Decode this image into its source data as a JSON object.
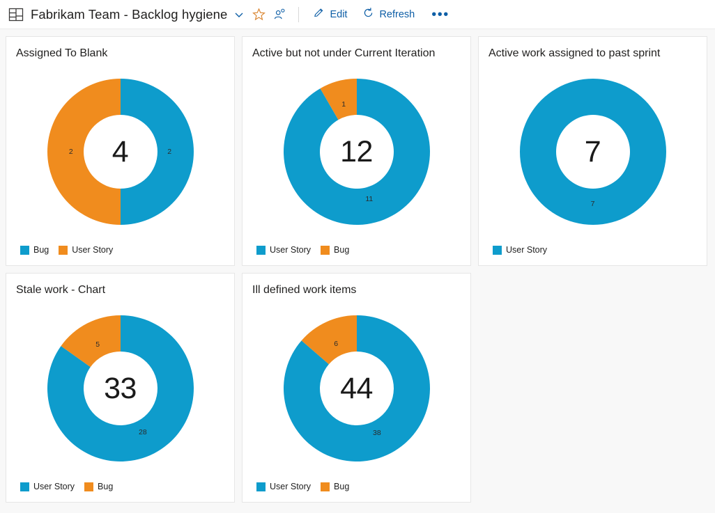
{
  "header": {
    "dashboard_icon": "dashboard-grid-icon",
    "title": "Fabrikam Team - Backlog hygiene",
    "chevron_icon": "chevron-down-icon",
    "favorite_icon": "star-icon",
    "share_icon": "people-icon",
    "edit": {
      "icon": "pencil-icon",
      "label": "Edit"
    },
    "refresh": {
      "icon": "refresh-icon",
      "label": "Refresh"
    },
    "more_label": "•••"
  },
  "colors": {
    "blue": "#0e9ccc",
    "orange": "#f08c1e",
    "page_background": "#f8f8f8",
    "card_background": "#ffffff",
    "card_border": "#e6e6e6",
    "command_link": "#0d5ea6",
    "title_text": "#201f1e"
  },
  "chart_data": [
    {
      "type": "pie",
      "title": "Assigned To Blank",
      "total": 4,
      "legend_position": "bottom-left",
      "categories": [
        "Bug",
        "User Story"
      ],
      "values": [
        2,
        2
      ],
      "colors": [
        "#0e9ccc",
        "#f08c1e"
      ],
      "labels": [
        "2",
        "2"
      ]
    },
    {
      "type": "pie",
      "title": "Active but not under Current Iteration",
      "total": 12,
      "legend_position": "bottom-left",
      "categories": [
        "User Story",
        "Bug"
      ],
      "values": [
        11,
        1
      ],
      "colors": [
        "#0e9ccc",
        "#f08c1e"
      ],
      "labels": [
        "11",
        "1"
      ]
    },
    {
      "type": "pie",
      "title": "Active work assigned to past sprint",
      "total": 7,
      "legend_position": "bottom-left",
      "categories": [
        "User Story"
      ],
      "values": [
        7
      ],
      "colors": [
        "#0e9ccc"
      ],
      "labels": [
        "7"
      ]
    },
    {
      "type": "pie",
      "title": "Stale work - Chart",
      "total": 33,
      "legend_position": "bottom-left",
      "categories": [
        "User Story",
        "Bug"
      ],
      "values": [
        28,
        5
      ],
      "colors": [
        "#0e9ccc",
        "#f08c1e"
      ],
      "labels": [
        "28",
        "5"
      ]
    },
    {
      "type": "pie",
      "title": "Ill defined work items",
      "total": 44,
      "legend_position": "bottom-left",
      "categories": [
        "User Story",
        "Bug"
      ],
      "values": [
        38,
        6
      ],
      "colors": [
        "#0e9ccc",
        "#f08c1e"
      ],
      "labels": [
        "38",
        "6"
      ]
    }
  ]
}
